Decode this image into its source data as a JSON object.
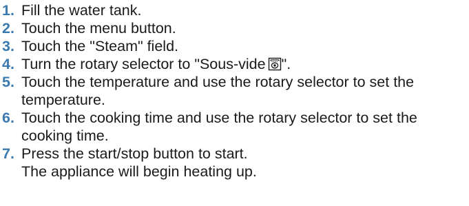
{
  "steps": [
    {
      "number": "1.",
      "text": "Fill the water tank."
    },
    {
      "number": "2.",
      "text": "Touch the menu button."
    },
    {
      "number": "3.",
      "text": "Touch the \"Steam\" field."
    },
    {
      "number": "4.",
      "text_before": "Turn the rotary selector to \"Sous-vide",
      "icon": "sous-vide-icon",
      "text_after": "\"."
    },
    {
      "number": "5.",
      "text": "Touch the temperature and use the rotary selector to set the temperature."
    },
    {
      "number": "6.",
      "text": "Touch the cooking time and use the rotary selector to set the cooking time."
    },
    {
      "number": "7.",
      "text": "Press the start/stop button to start.",
      "result": "The appliance will begin heating up."
    }
  ]
}
